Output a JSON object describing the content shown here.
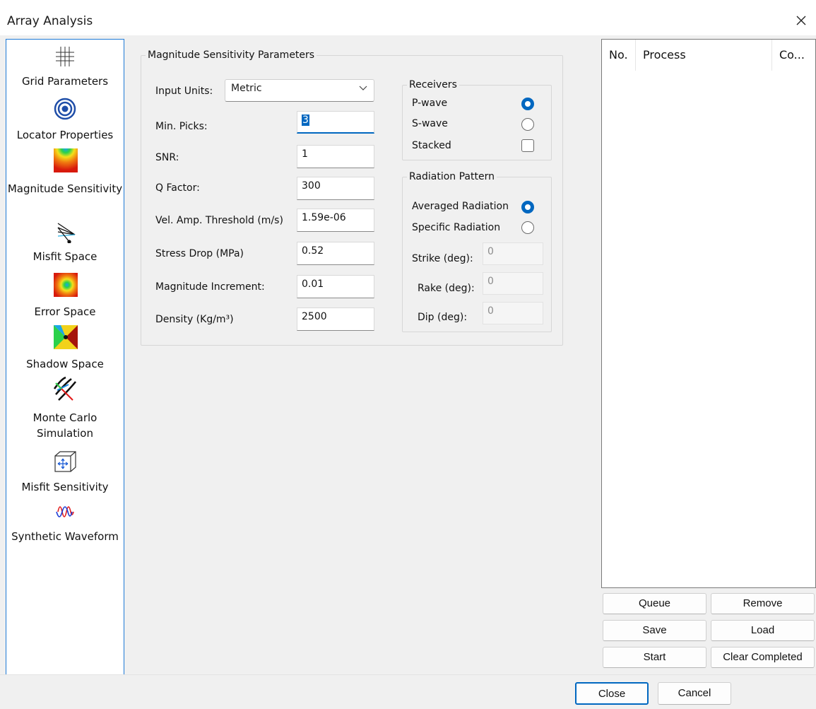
{
  "window": {
    "title": "Array Analysis"
  },
  "sidebar": {
    "items": [
      {
        "label": "Grid Parameters",
        "icon": "grid-icon"
      },
      {
        "label": "Locator Properties",
        "icon": "target-icon"
      },
      {
        "label": "Magnitude Sensitivity",
        "icon": "heatmap-icon"
      },
      {
        "label": "Misfit Space",
        "icon": "ray-paths-icon"
      },
      {
        "label": "Error Space",
        "icon": "error-ellipse-icon"
      },
      {
        "label": "Shadow Space",
        "icon": "shadow-wedge-icon"
      },
      {
        "label": "Monte Carlo Simulation",
        "icon": "wavefront-icon"
      },
      {
        "label": "Misfit Sensitivity",
        "icon": "cube-arrows-icon"
      },
      {
        "label": "Synthetic Waveform",
        "icon": "waveform-icon"
      }
    ]
  },
  "params": {
    "legend": "Magnitude Sensitivity Parameters",
    "input_units_label": "Input Units:",
    "input_units_value": "Metric",
    "fields": [
      {
        "label": "Min. Picks:",
        "value": "3"
      },
      {
        "label": "SNR:",
        "value": "1"
      },
      {
        "label": "Q Factor:",
        "value": "300"
      },
      {
        "label": "Vel. Amp. Threshold (m/s)",
        "value": "1.59e-06"
      },
      {
        "label": "Stress Drop (MPa)",
        "value": "0.52"
      },
      {
        "label": "Magnitude Increment:",
        "value": "0.01"
      },
      {
        "label": "Density (Kg/m³)",
        "value": "2500"
      }
    ]
  },
  "receivers": {
    "legend": "Receivers",
    "pwave": "P-wave",
    "swave": "S-wave",
    "stacked": "Stacked",
    "selected": "P-wave"
  },
  "radiation": {
    "legend": "Radiation Pattern",
    "averaged": "Averaged Radiation",
    "specific": "Specific Radiation",
    "selected": "Averaged Radiation",
    "strike_label": "Strike (deg):",
    "strike_value": "0",
    "rake_label": "Rake (deg):",
    "rake_value": "0",
    "dip_label": "Dip (deg):",
    "dip_value": "0"
  },
  "queue": {
    "columns": [
      "No.",
      "Process",
      "Co..."
    ],
    "buttons": {
      "queue": "Queue",
      "remove": "Remove",
      "save": "Save",
      "load": "Load",
      "start": "Start",
      "clear": "Clear Completed"
    }
  },
  "footer": {
    "close": "Close",
    "cancel": "Cancel"
  },
  "colors": {
    "accent": "#0067c0",
    "sidebar_border": "#1e7ad6"
  }
}
